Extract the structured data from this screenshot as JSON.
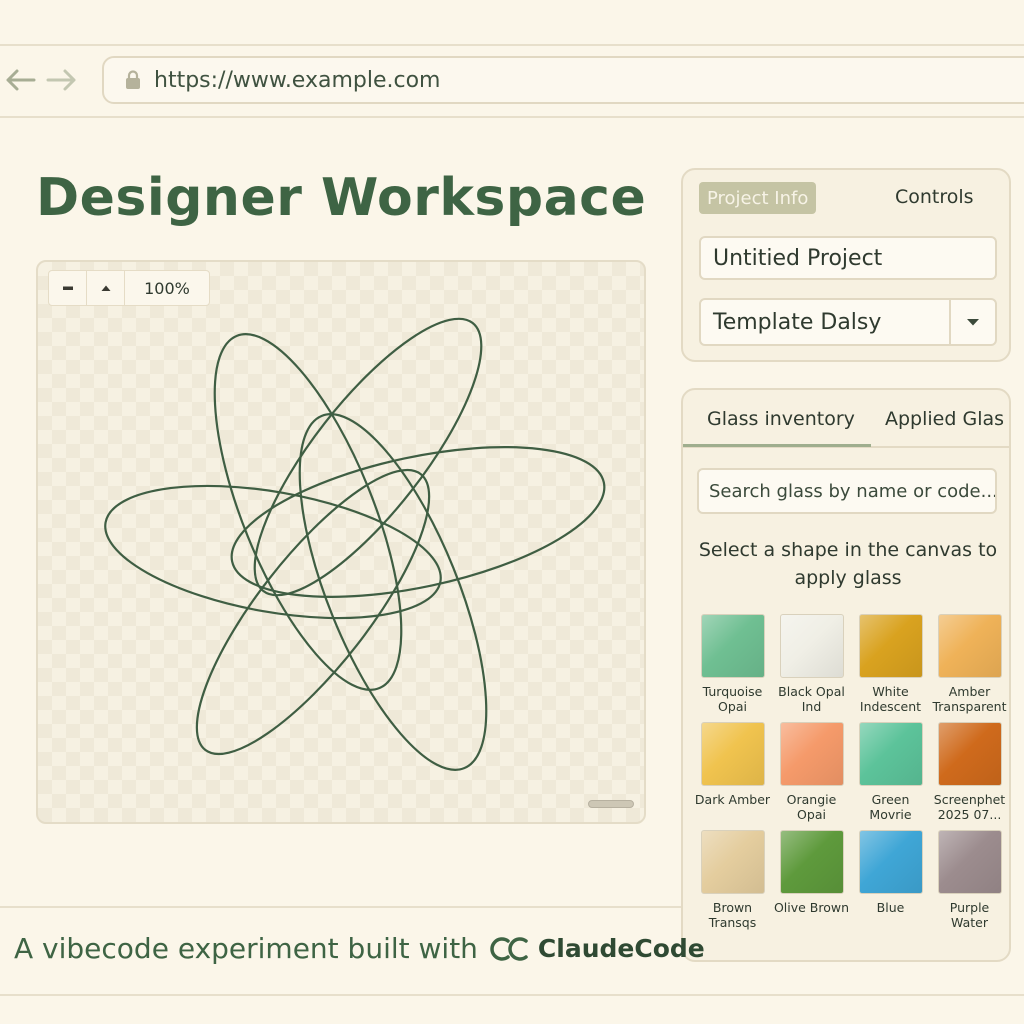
{
  "browser": {
    "url": "https://www.example.com",
    "back_icon": "arrow-left-icon",
    "forward_icon": "arrow-right-icon",
    "lock_icon": "lock-icon"
  },
  "page": {
    "title": "Designer Workspace"
  },
  "canvas": {
    "zoom_out_icon": "minus-icon",
    "zoom_in_icon": "triangle-up-icon",
    "zoom_level": "100%"
  },
  "project_panel": {
    "tabs": [
      {
        "label": "Project Info",
        "active": true
      },
      {
        "label": "Controls",
        "active": false
      }
    ],
    "project_name": "Untitied Project",
    "template": "Template Dalsy"
  },
  "glass_panel": {
    "tabs": [
      {
        "label": "Glass inventory",
        "active": true
      },
      {
        "label": "Applied Glas",
        "active": false
      }
    ],
    "search_placeholder": "Search glass by name or code...",
    "hint": "Select a shape in the canvas to apply glass",
    "swatches": [
      {
        "name": "Turquoise Opai",
        "color": "#6fbf92"
      },
      {
        "name": "Black Opal Ind",
        "color": "#f0efe6"
      },
      {
        "name": "White Indescent",
        "color": "#d9a21f"
      },
      {
        "name": "Amber Transparent",
        "color": "#efb258"
      },
      {
        "name": "Dark Amber",
        "color": "#f0c34e"
      },
      {
        "name": "Orangie Opai",
        "color": "#f59a6a"
      },
      {
        "name": "Green Movrie",
        "color": "#5cc39a"
      },
      {
        "name": "Screenphet 2025 07...",
        "color": "#cf6a1c"
      },
      {
        "name": "Brown Transqs",
        "color": "#e4cd9e"
      },
      {
        "name": "Olive Brown",
        "color": "#5e9a3c"
      },
      {
        "name": "Blue",
        "color": "#3fa6d6"
      },
      {
        "name": "Purple Water",
        "color": "#9c8c8e"
      }
    ]
  },
  "footer": {
    "text": "A vibecode experiment built with",
    "brand": "ClaudeCode"
  },
  "colors": {
    "background": "#fbf6e9",
    "accent_green": "#3e6444",
    "panel_border": "#e3dac4"
  }
}
